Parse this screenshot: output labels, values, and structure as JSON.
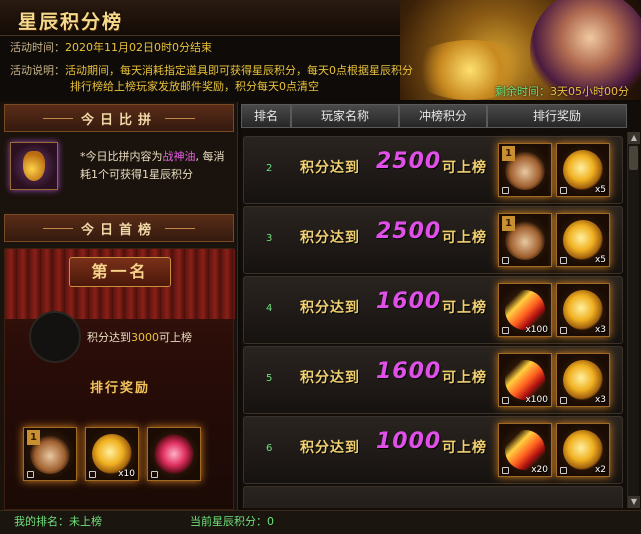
{
  "title": "星辰积分榜",
  "info": {
    "time_label": "活动时间：",
    "time_value": "2020年11月02日0时0分结束",
    "desc_label": "活动说明：",
    "desc_line1": "活动期间，每天消耗指定道具即可获得星辰积分，每天0点根据星辰积分",
    "desc_line2": "排行榜给上榜玩家发放邮件奖励，积分每天0点清空",
    "remain_label": "剩余时间：",
    "remain_value": "3天05小时00分"
  },
  "left": {
    "today_compete": "今日比拼",
    "compete_desc_pre": "*今日比拼内容为",
    "compete_item": "战神油",
    "compete_desc_post": ", 每消耗1个可获得1星辰积分",
    "today_first": "今日首榜",
    "first_place": "第一名",
    "first_text_pre": "积分达到",
    "first_text_num": "3000",
    "first_text_post": "可上榜",
    "reward_title": "排行奖励",
    "rewards": [
      {
        "icon": "glove-icon",
        "count": "",
        "rank": "1"
      },
      {
        "icon": "coin-icon",
        "count": "x10",
        "rank": ""
      },
      {
        "icon": "flower-icon",
        "count": "",
        "rank": ""
      }
    ]
  },
  "table": {
    "headers": [
      "排名",
      "玩家名称",
      "冲榜积分",
      "排行奖励"
    ],
    "rows": [
      {
        "rank": "2",
        "qual": "积分达到",
        "score": "2500",
        "tail": "可上榜",
        "r1": {
          "icon": "glove-icon",
          "count": "",
          "rank": "1"
        },
        "r2": {
          "icon": "coin-icon",
          "count": "x5"
        }
      },
      {
        "rank": "3",
        "qual": "积分达到",
        "score": "2500",
        "tail": "可上榜",
        "r1": {
          "icon": "glove-icon",
          "count": "",
          "rank": "1"
        },
        "r2": {
          "icon": "coin-icon",
          "count": "x5"
        }
      },
      {
        "rank": "4",
        "qual": "积分达到",
        "score": "1600",
        "tail": "可上榜",
        "r1": {
          "icon": "feather-icon",
          "count": "x100"
        },
        "r2": {
          "icon": "coin-icon",
          "count": "x3"
        }
      },
      {
        "rank": "5",
        "qual": "积分达到",
        "score": "1600",
        "tail": "可上榜",
        "r1": {
          "icon": "feather-icon",
          "count": "x100"
        },
        "r2": {
          "icon": "coin-icon",
          "count": "x3"
        }
      },
      {
        "rank": "6",
        "qual": "积分达到",
        "score": "1000",
        "tail": "可上榜",
        "r1": {
          "icon": "feather-icon",
          "count": "x20"
        },
        "r2": {
          "icon": "coin-icon",
          "count": "x2"
        }
      }
    ]
  },
  "footer": {
    "my_rank": "我的排名：未上榜",
    "my_score": "当前星辰积分：0"
  }
}
